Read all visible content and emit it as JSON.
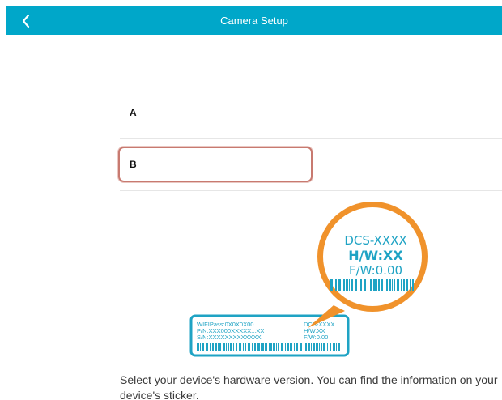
{
  "nav": {
    "title": "Camera Setup",
    "back_icon": "chevron-left-icon"
  },
  "options": [
    {
      "label": "A",
      "selected": false
    },
    {
      "label": "B",
      "selected": true
    }
  ],
  "sticker": {
    "bubble": {
      "model": "DCS-XXXX",
      "hw": "H/W:XX",
      "fw": "F/W:0.00"
    },
    "label": {
      "wifi": "WIFIPass:0X0X0X00",
      "pn": "P/N:XXX000XXXXX...XX",
      "sn": "S/N:XXXXXXXXXXXXX",
      "model": "DCS-XXXX",
      "hw": "H/W:XX",
      "fw": "F/W:0.00"
    }
  },
  "instruction": "Select your device's hardware version. You can find the information on your device's sticker.",
  "colors": {
    "nav_bg": "#00a7c9",
    "sticker_blue": "#1fa3c4",
    "bubble_orange": "#f0922b",
    "selection_border": "#c87a70"
  }
}
